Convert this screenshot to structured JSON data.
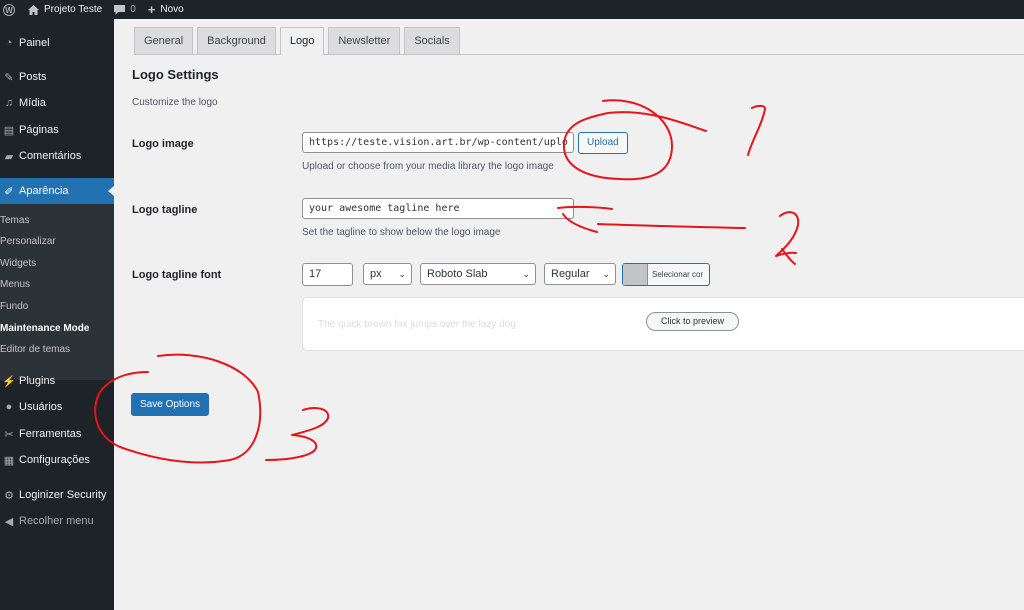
{
  "admin_bar": {
    "site_name": "Projeto Teste",
    "comments_count": "0",
    "new_label": "Novo"
  },
  "sidebar": {
    "items": [
      {
        "label": "Painel",
        "icon": "dashboard-icon"
      },
      {
        "label": "Posts",
        "icon": "pin-icon"
      },
      {
        "label": "Mídia",
        "icon": "media-icon"
      },
      {
        "label": "Páginas",
        "icon": "pages-icon"
      },
      {
        "label": "Comentários",
        "icon": "comment-icon"
      },
      {
        "label": "Aparência",
        "icon": "brush-icon"
      },
      {
        "label": "Plugins",
        "icon": "plugin-icon"
      },
      {
        "label": "Usuários",
        "icon": "users-icon"
      },
      {
        "label": "Ferramentas",
        "icon": "wrench-icon"
      },
      {
        "label": "Configurações",
        "icon": "settings-icon"
      },
      {
        "label": "Loginizer Security",
        "icon": "gear-icon"
      },
      {
        "label": "Recolher menu",
        "icon": "collapse-icon"
      }
    ],
    "submenu": [
      "Temas",
      "Personalizar",
      "Widgets",
      "Menus",
      "Fundo",
      "Maintenance Mode",
      "Editor de temas"
    ]
  },
  "tabs": [
    "General",
    "Background",
    "Logo",
    "Newsletter",
    "Socials"
  ],
  "page": {
    "title": "Logo Settings",
    "subtitle": "Customize the logo",
    "logo_image_label": "Logo image",
    "logo_image_value": "https://teste.vision.art.br/wp-content/uplo",
    "upload_label": "Upload",
    "logo_image_desc": "Upload or choose from your media library the logo image",
    "tagline_label": "Logo tagline",
    "tagline_value": "your awesome tagline here",
    "tagline_desc": "Set the tagline to show below the logo image",
    "font_label": "Logo tagline font",
    "font_size": "17",
    "font_unit": "px",
    "font_family": "Roboto Slab",
    "font_weight": "Regular",
    "color_button": "Selecionar cor",
    "preview_text": "The quick brown fox jumps over the lazy dog",
    "preview_button": "Click to preview",
    "save_label": "Save Options"
  },
  "annotations": [
    "1",
    "2",
    "3"
  ],
  "colors": {
    "accent": "#2271b1",
    "admin_dark": "#1d2327",
    "annotation_red": "#e8141a"
  }
}
